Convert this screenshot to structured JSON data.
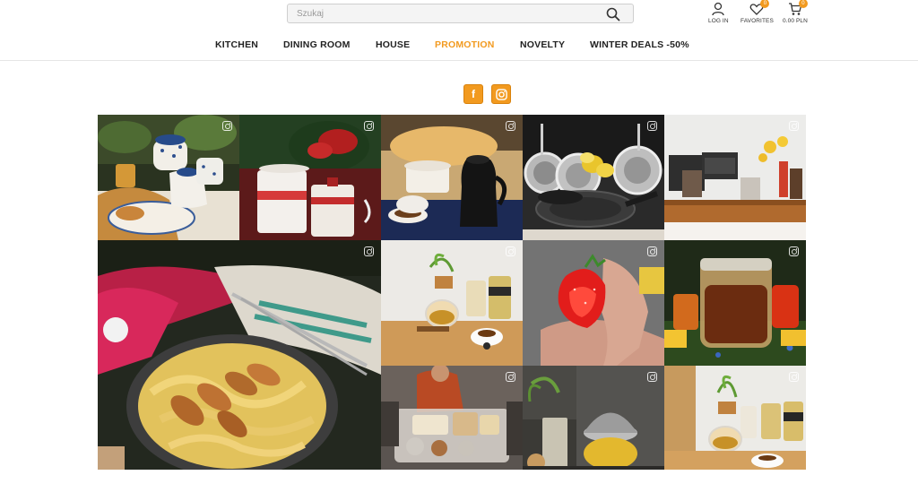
{
  "search": {
    "placeholder": "Szukaj"
  },
  "account": {
    "login_label": "LOG IN",
    "favorites_label": "FAVORITES",
    "favorites_count": "0",
    "cart_label": "0.00 PLN",
    "cart_count": "0"
  },
  "nav": {
    "items": [
      {
        "label": "KITCHEN"
      },
      {
        "label": "DINING ROOM"
      },
      {
        "label": "HOUSE"
      },
      {
        "label": "PROMOTION"
      },
      {
        "label": "NOVELTY"
      },
      {
        "label": "WINTER DEALS -50%"
      }
    ],
    "active_color": "#f29a1f"
  },
  "social": {
    "facebook_icon": "f",
    "instagram_icon": "instagram-icon"
  },
  "gallery": {
    "tiles": [
      {
        "name": "tea-set-breakfast-photo"
      },
      {
        "name": "christmas-mugs-photo"
      },
      {
        "name": "kettle-and-cup-photo"
      },
      {
        "name": "frying-pans-photo"
      },
      {
        "name": "kitchen-counter-photo"
      },
      {
        "name": "pasta-with-chicken-photo"
      },
      {
        "name": "tea-and-jars-photo"
      },
      {
        "name": "strawberry-hand-photo"
      },
      {
        "name": "honey-jar-photo"
      },
      {
        "name": "storage-containers-photo"
      },
      {
        "name": "spices-jar-photo"
      },
      {
        "name": "tea-jars-photo-2"
      }
    ]
  },
  "colors": {
    "accent": "#f29a1f",
    "text": "#222222"
  }
}
